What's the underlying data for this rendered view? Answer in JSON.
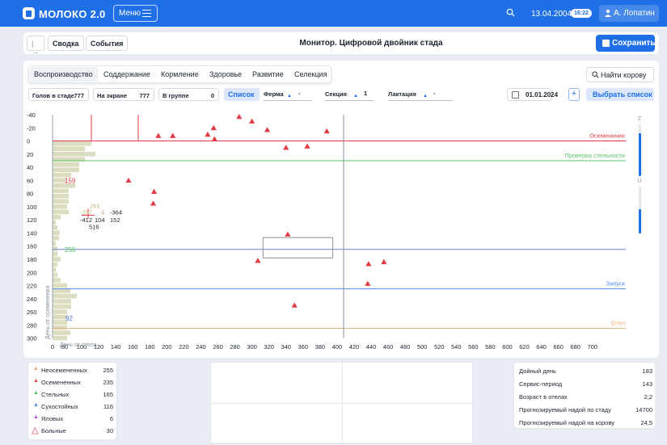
{
  "app": {
    "title": "МОЛОКО 2.0",
    "menu_label": "Меню",
    "date": "13.04.2004",
    "time": "16:22",
    "user": "А. Лопатин"
  },
  "subbar": {
    "summary_label": "Сводка",
    "events_label": "События",
    "page_title": "Монитор. Цифровой двойник стада",
    "save_label": "Сохранить"
  },
  "tabs": [
    "Воспроизводство",
    "Соддержание",
    "Кормление",
    "Здоровье",
    "Развитие",
    "Селекция"
  ],
  "active_tab": "Воспроизводство",
  "find_label": "Найти корову",
  "filters": {
    "herd_label": "Голов в стаде",
    "herd_value": "777",
    "screen_label": "На экране",
    "screen_value": "777",
    "group_label": "В группе",
    "group_value": "0",
    "list_label": "Список",
    "farm_label": "Ферма",
    "farm_value": "-",
    "section_label": "Секция",
    "section_value": "1",
    "lactation_label": "Лактация",
    "lactation_value": "-",
    "date_value": "01.01.2024",
    "plus_label": "+",
    "pick_list_label": "Выбрать список"
  },
  "chart_data": {
    "type": "scatter",
    "xlabel": "День от отела",
    "ylabel": "День от осеменения",
    "x_ticks": [
      0,
      80,
      100,
      120,
      140,
      160,
      180,
      200,
      220,
      240,
      260,
      280,
      300,
      320,
      340,
      360,
      380,
      400,
      420,
      440,
      460,
      480,
      500,
      520,
      540,
      560,
      580,
      600,
      620,
      640,
      660,
      680,
      700
    ],
    "y_ticks": [
      -40,
      -20,
      0,
      20,
      40,
      60,
      80,
      100,
      120,
      140,
      160,
      180,
      200,
      220,
      240,
      260,
      280,
      300
    ],
    "xlim": [
      0,
      700
    ],
    "ylim": [
      -40,
      300
    ],
    "reference_lines": [
      {
        "label": "Осеменение",
        "y": 0,
        "color": "#e23b45"
      },
      {
        "label": "Проверка стельности",
        "y": 30,
        "color": "#5bc46a"
      },
      {
        "label": "",
        "y": 165,
        "color": "#6e86c9"
      },
      {
        "label": "Запуск",
        "y": 225,
        "color": "#4f8ee8"
      },
      {
        "label": "Отел",
        "y": 285,
        "color": "#f2b27a"
      }
    ],
    "vertical_markers": [
      {
        "x": 50
      },
      {
        "x": 105
      },
      {
        "x": 360
      }
    ],
    "points": [
      {
        "x": 190,
        "y": -8
      },
      {
        "x": 207,
        "y": -8
      },
      {
        "x": 248,
        "y": -10
      },
      {
        "x": 255,
        "y": -20
      },
      {
        "x": 256,
        "y": -3
      },
      {
        "x": 285,
        "y": -37
      },
      {
        "x": 300,
        "y": -30
      },
      {
        "x": 318,
        "y": -17
      },
      {
        "x": 340,
        "y": 10
      },
      {
        "x": 365,
        "y": 8
      },
      {
        "x": 388,
        "y": -15
      },
      {
        "x": 155,
        "y": 60
      },
      {
        "x": 185,
        "y": 77
      },
      {
        "x": 184,
        "y": 95
      },
      {
        "x": 342,
        "y": 142
      },
      {
        "x": 307,
        "y": 182
      },
      {
        "x": 437,
        "y": 187
      },
      {
        "x": 455,
        "y": 184
      },
      {
        "x": 436,
        "y": 217
      },
      {
        "x": 350,
        "y": 250
      }
    ],
    "histogram": [
      {
        "y": 0,
        "w": 48
      },
      {
        "y": 8,
        "w": 40
      },
      {
        "y": 16,
        "w": 53
      },
      {
        "y": 24,
        "w": 40
      },
      {
        "y": 32,
        "w": 33
      },
      {
        "y": 40,
        "w": 33
      },
      {
        "y": 48,
        "w": 23
      },
      {
        "y": 56,
        "w": 17
      },
      {
        "y": 64,
        "w": 28
      },
      {
        "y": 72,
        "w": 20
      },
      {
        "y": 80,
        "w": 20
      },
      {
        "y": 88,
        "w": 20
      },
      {
        "y": 96,
        "w": 18
      },
      {
        "y": 104,
        "w": 20
      },
      {
        "y": 112,
        "w": 10
      },
      {
        "y": 120,
        "w": 4
      },
      {
        "y": 128,
        "w": 6
      },
      {
        "y": 136,
        "w": 9
      },
      {
        "y": 144,
        "w": 8
      },
      {
        "y": 152,
        "w": 4
      },
      {
        "y": 160,
        "w": 6
      },
      {
        "y": 168,
        "w": 6
      },
      {
        "y": 176,
        "w": 10
      },
      {
        "y": 184,
        "w": 6
      },
      {
        "y": 192,
        "w": 4
      },
      {
        "y": 200,
        "w": 6
      },
      {
        "y": 208,
        "w": 10
      },
      {
        "y": 216,
        "w": 18
      },
      {
        "y": 224,
        "w": 22
      },
      {
        "y": 232,
        "w": 30
      },
      {
        "y": 240,
        "w": 23
      },
      {
        "y": 248,
        "w": 23
      },
      {
        "y": 256,
        "w": 18
      },
      {
        "y": 264,
        "w": 18
      },
      {
        "y": 272,
        "w": 18
      },
      {
        "y": 280,
        "w": 18
      },
      {
        "y": 288,
        "w": 22
      },
      {
        "y": 296,
        "w": 18
      }
    ],
    "annotations": [
      {
        "text": "159",
        "x": 5,
        "y": 60,
        "color": "#e23b45"
      },
      {
        "text": "256",
        "x": 5,
        "y": 165,
        "color": "#4bbf5a"
      },
      {
        "text": "92",
        "x": 6,
        "y": 270,
        "color": "#4f6fe6"
      }
    ],
    "crosshair_labels": [
      {
        "text": "261",
        "x": 28,
        "y": 98,
        "color": "#c9b07a"
      },
      {
        "text": "-257",
        "x": 16,
        "y": 108,
        "color": "#c9b07a"
      },
      {
        "text": "4",
        "x": 42,
        "y": 108,
        "color": "#c9b07a"
      },
      {
        "text": "-364",
        "x": 53,
        "y": 108,
        "color": "#1c2430"
      },
      {
        "text": "-412",
        "x": 16,
        "y": 120,
        "color": "#1c2430"
      },
      {
        "text": "104",
        "x": 34,
        "y": 120,
        "color": "#1c2430"
      },
      {
        "text": "152",
        "x": 53,
        "y": 120,
        "color": "#1c2430"
      },
      {
        "text": "516",
        "x": 27,
        "y": 130,
        "color": "#1c2430"
      }
    ],
    "selection_box": {
      "x0": 313,
      "y0": 147,
      "x1": 395,
      "y1": 178
    },
    "slider_z_label": "Z",
    "slider_u_label": "U"
  },
  "legend": [
    {
      "label": "Неосемененных",
      "value": "255",
      "color": "#f2a66e",
      "icon": "triangle"
    },
    {
      "label": "Осемененных",
      "value": "235",
      "color": "#e23b45",
      "icon": "triangle"
    },
    {
      "label": "Стельных",
      "value": "165",
      "color": "#4bbf5a",
      "icon": "triangle"
    },
    {
      "label": "Сухостойных",
      "value": "116",
      "color": "#4f8ee8",
      "icon": "triangle"
    },
    {
      "label": "Яловых",
      "value": "6",
      "color": "#b04fd6",
      "icon": "triangle"
    },
    {
      "label": "Больные",
      "value": "30",
      "color": "#e23b45",
      "icon": "triangle-outline"
    }
  ],
  "stats": [
    {
      "label": "Дойный день",
      "value": "183"
    },
    {
      "label": "Сервис-период",
      "value": "143"
    },
    {
      "label": "Возраст в отелах",
      "value": "2,2"
    },
    {
      "label": "Прогнозируемый надой по стаду",
      "value": "14700"
    },
    {
      "label": "Прогнозируемый надой на корову",
      "value": "24,5"
    }
  ]
}
